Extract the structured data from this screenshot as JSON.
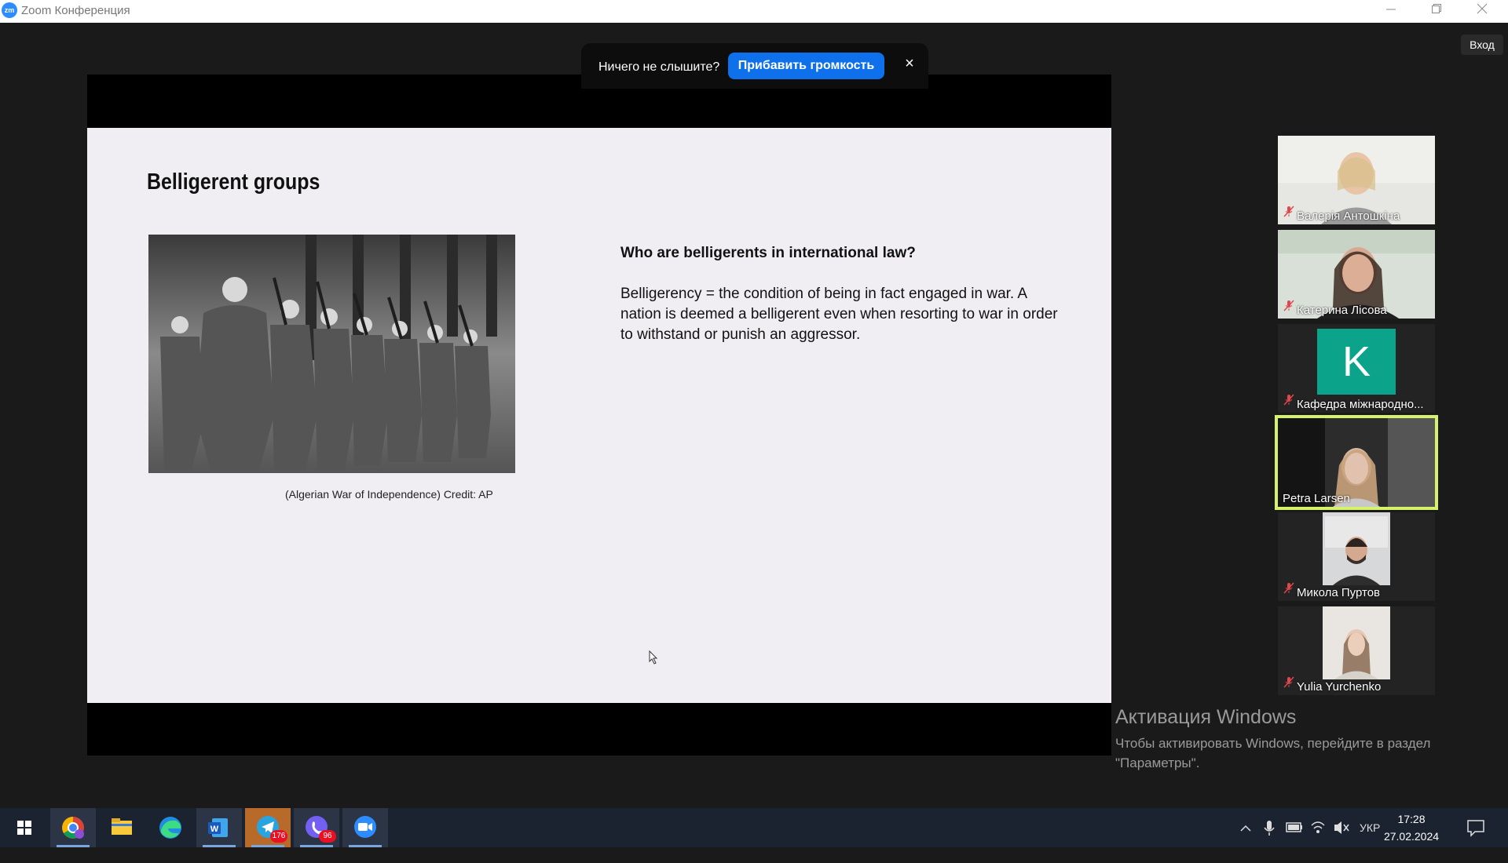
{
  "window": {
    "title": "Zoom Конференция",
    "logo_text": "zm"
  },
  "header": {
    "signin_label": "Вход"
  },
  "notification": {
    "text": "Ничего не слышите?",
    "button_label": "Прибавить громкость",
    "close_glyph": "×"
  },
  "slide": {
    "title": "Belligerent groups",
    "caption": "(Algerian War of Independence) Credit: AP",
    "question": "Who are belligerents in international law?",
    "body": "Belligerency = the condition of being in fact engaged in war. A nation is deemed a belligerent even when resorting to war in order to withstand or punish an aggressor."
  },
  "participants": [
    {
      "name": "Валерія Антошкіна",
      "muted": true
    },
    {
      "name": "Катерина Лісова",
      "muted": true
    },
    {
      "name": "Кафедра міжнародно...",
      "muted": true,
      "avatar_letter": "K"
    },
    {
      "name": "Petra Larsen",
      "muted": false,
      "active_speaker": true
    },
    {
      "name": "Микола Пуртов",
      "muted": true
    },
    {
      "name": "Yulia Yurchenko",
      "muted": true
    }
  ],
  "watermark": {
    "title": "Активация Windows",
    "text": "Чтобы активировать Windows, перейдите в раздел \"Параметры\"."
  },
  "taskbar": {
    "apps": [
      {
        "name": "start-icon"
      },
      {
        "name": "chrome-icon"
      },
      {
        "name": "file-explorer-icon"
      },
      {
        "name": "edge-icon"
      },
      {
        "name": "word-icon"
      },
      {
        "name": "telegram-icon",
        "badge": "176"
      },
      {
        "name": "viber-icon",
        "badge": "96"
      },
      {
        "name": "zoom-icon"
      }
    ],
    "language": "УКР",
    "time": "17:28",
    "date": "27.02.2024"
  }
}
